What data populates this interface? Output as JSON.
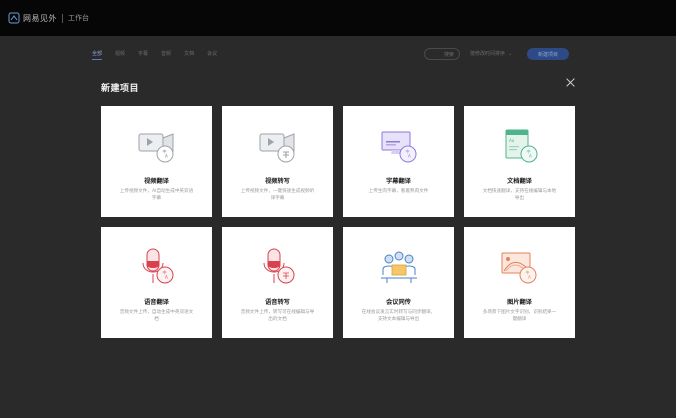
{
  "app": {
    "brand": "网易见外",
    "workbench": "工作台"
  },
  "background": {
    "tabs": [
      "全部",
      "视频",
      "字幕",
      "音频",
      "文档",
      "会议"
    ],
    "search_label": "搜索",
    "sort_label": "按修改时间排序",
    "new_project_button": "新建项目"
  },
  "dialog": {
    "title": "新建项目",
    "cards": [
      {
        "title": "视频翻译",
        "desc": "上传视频文件，AI自动生成中英双语字幕",
        "icon": "video-translate-icon"
      },
      {
        "title": "视频转写",
        "desc": "上传视频文件，一键快速生成视频听译字幕",
        "icon": "video-transcribe-icon"
      },
      {
        "title": "字幕翻译",
        "desc": "上传生肉字幕，看着熟肉文件",
        "icon": "subtitle-translate-icon"
      },
      {
        "title": "文档翻译",
        "desc": "文档快速翻译，支持在线编辑与本地导出",
        "icon": "document-translate-icon"
      },
      {
        "title": "语音翻译",
        "desc": "音频文件上传，自动生成中英双语文档",
        "icon": "voice-translate-icon"
      },
      {
        "title": "语音转写",
        "desc": "音频文件上传，转写可在线编辑与导出的文档",
        "icon": "voice-transcribe-icon"
      },
      {
        "title": "会议同传",
        "desc": "在线会议发言实时转写与同步翻译，支持文本编辑与导出",
        "icon": "meeting-interpret-icon"
      },
      {
        "title": "图片翻译",
        "desc": "多场景下图片文字识别，识别结果一键翻译",
        "icon": "image-translate-icon"
      }
    ]
  },
  "colors": {
    "topbar": "#060606",
    "overlay": "#2a2a2a",
    "card": "#ffffff",
    "accent_blue": "#2e4a86",
    "purple": "#8f7bd8",
    "green": "#4fb48c",
    "red": "#d9424c",
    "orange": "#e4805c"
  }
}
